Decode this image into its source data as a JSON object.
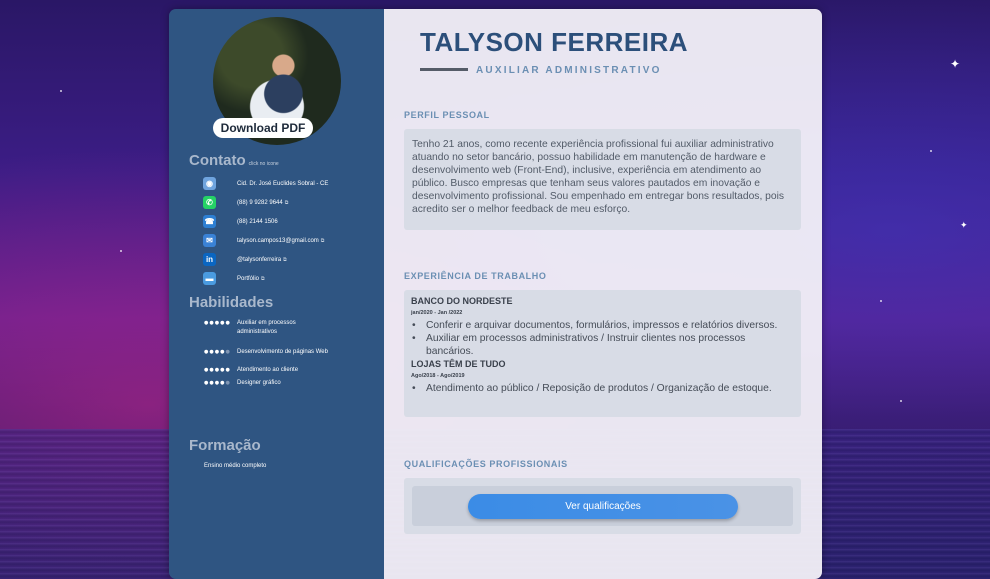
{
  "profile": {
    "download_label": "Download PDF"
  },
  "contact": {
    "title": "Contato",
    "hint": "click no icone",
    "items": [
      {
        "icon": "location-icon",
        "text": "Cid. Dr. José Euclides Sobral - CE",
        "color": "#6fa4de",
        "ext": false
      },
      {
        "icon": "whatsapp-icon",
        "text": "(88) 9 9282 9644",
        "color": "#25d366",
        "ext": true
      },
      {
        "icon": "phone-icon",
        "text": "(88) 2144 1506",
        "color": "#2d7fd3",
        "ext": false
      },
      {
        "icon": "email-icon",
        "text": "talyson.campos13@gmail.com",
        "color": "#3a82d6",
        "ext": true
      },
      {
        "icon": "linkedin-icon",
        "text": "@talysonferreira",
        "color": "#0a66c2",
        "ext": true
      },
      {
        "icon": "folder-icon",
        "text": "Portfólio",
        "color": "#4a9be0",
        "ext": true
      }
    ]
  },
  "skills": {
    "title": "Habilidades",
    "items": [
      {
        "label": "Auxiliar em processos administrativos",
        "level": 5
      },
      {
        "label": "Desenvolvimento de páginas Web",
        "level": 4
      },
      {
        "label": "Atendimento ao cliente",
        "level": 5
      },
      {
        "label": "Designer gráfico",
        "level": 4
      }
    ]
  },
  "education": {
    "title": "Formação",
    "text": "Ensino médio completo"
  },
  "header": {
    "name": "TALYSON FERREIRA",
    "subtitle": "AUXILIAR ADMINISTRATIVO"
  },
  "perfil": {
    "heading": "PERFIL PESSOAL",
    "text": "Tenho 21 anos, como recente experiência profissional fui auxiliar administrativo atuando no setor bancário, possuo habilidade em manutenção de hardware e desenvolvimento web (Front-End), inclusive, experiência em atendimento ao público. Busco empresas que tenham seus valores pautados em inovação e desenvolvimento profissional. Sou empenhado em entregar bons resultados, pois acredito ser o melhor feedback de meu esforço."
  },
  "experiencia": {
    "heading": "EXPERIÊNCIA DE TRABALHO",
    "jobs": [
      {
        "company": "BANCO DO NORDESTE",
        "dates": "jan/2020 - Jan /2022",
        "bullets": [
          "Conferir e arquivar documentos, formulários, impressos e relatórios diversos.",
          "Auxiliar em processos administrativos / Instruir clientes nos processos bancários."
        ]
      },
      {
        "company": "LOJAS TÊM DE TUDO",
        "dates": "Ago/2018 - Ago/2019",
        "bullets": [
          "Atendimento ao público / Reposição de produtos / Organização de estoque."
        ]
      }
    ]
  },
  "qualificacoes": {
    "heading": "QUALIFICAÇÕES PROFISSIONAIS",
    "button_label": "Ver qualificações"
  },
  "colors": {
    "sidebar": "#2f5582",
    "accent": "#2c4f7a",
    "button": "#3b8ce6"
  }
}
